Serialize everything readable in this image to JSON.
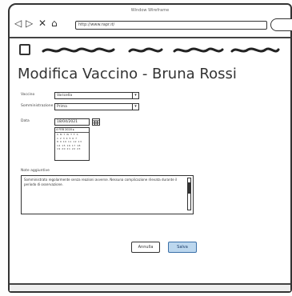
{
  "window": {
    "title": "Window Wireframe",
    "url": "http://www.rapr.it/"
  },
  "page": {
    "title": "Modifica Vaccino - Bruna Rossi"
  },
  "form": {
    "vaccine_label": "Vaccino",
    "vaccine_value": "Varicella",
    "dose_label": "Somministrazione",
    "dose_value": "Prima",
    "date_label": "Data",
    "date_value": "18/04/2021",
    "calendar_header": "4 FEB 2020 ▸",
    "calendar_rows": [
      "S M T W T F S",
      "1 2 3 4 5 6 7",
      "8 9 10 11 12 13",
      "14 15 16 17 18",
      "19 20 21 22 23"
    ],
    "notes_label": "Note aggiuntive",
    "notes_value": "Somministrato regolarmente senza reazioni avverse. Nessuna complicazione rilevata durante il periodo di osservazione."
  },
  "actions": {
    "cancel_label": "Annulla",
    "save_label": "Salva"
  },
  "colors": {
    "primary_button": "#bcd7ee"
  }
}
